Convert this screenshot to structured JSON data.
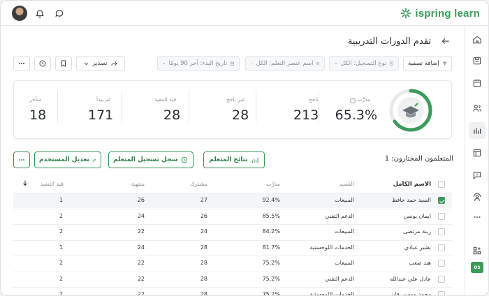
{
  "brand": {
    "name": "ispring learn",
    "accent": "#3d9a5b"
  },
  "page": {
    "title": "تقدم الدورات التدريبية"
  },
  "toolbar": {
    "add_filter": "إضافة تصفية",
    "enrollment_type": "نوع التسجيل: الكل",
    "learning_item": "اسم عنصر التعلم: الكل",
    "start_date": "تاريخ البدء: آخر 90 يومًا",
    "export": "تصدير"
  },
  "summary": {
    "trained_label": "مدرَّب",
    "trained_value": "65.3%",
    "trained_fraction": 0.653,
    "passed_label": "ناجح",
    "passed_value": "213",
    "failed_label": "غير ناجح",
    "failed_value": "28",
    "in_progress_label": "قيد التنفيذ",
    "in_progress_value": "28",
    "not_started_label": "لم يبدأ",
    "not_started_value": "171",
    "overdue_label": "متأخر",
    "overdue_value": "18"
  },
  "selection": {
    "count_text": "المتعلمون المختارون: 1",
    "results_button": "نتائج المتعلم",
    "enrollment_log_button": "سجل تسجيل المتعلم",
    "edit_user_button": "تعديل المستخدم"
  },
  "table": {
    "headers": {
      "name": "الاسم الكامل",
      "department": "القسم",
      "trained": "مدرَّب",
      "enrolled": "مشترك",
      "completed": "منتهية",
      "in_progress": "قيد التنفيذ"
    },
    "rows": [
      {
        "name": "السيد حمد حافظ",
        "department": "المبيعات",
        "trained": "92.4%",
        "enrolled": "27",
        "completed": "26",
        "in_progress": "1",
        "checked": true
      },
      {
        "name": "ايمان يونس",
        "department": "الدعم التقني",
        "trained": "85.5%",
        "enrolled": "26",
        "completed": "24",
        "in_progress": "2",
        "checked": false
      },
      {
        "name": "زينة مرتضى",
        "department": "المبيعات",
        "trained": "84.2%",
        "enrolled": "24",
        "completed": "22",
        "in_progress": "2",
        "checked": false
      },
      {
        "name": "بشير عبادي",
        "department": "الخدمات اللوجستية",
        "trained": "81.7%",
        "enrolled": "28",
        "completed": "24",
        "in_progress": "1",
        "checked": false
      },
      {
        "name": "هند صعب",
        "department": "المبيعات",
        "trained": "75.2%",
        "enrolled": "28",
        "completed": "22",
        "in_progress": "2",
        "checked": false
      },
      {
        "name": "عادل علي عبدالله",
        "department": "الدعم التقني",
        "trained": "75.2%",
        "enrolled": "28",
        "completed": "22",
        "in_progress": "2",
        "checked": false
      },
      {
        "name": "محمد موسى فايز",
        "department": "الخدمات اللوجستية",
        "trained": "75.2%",
        "enrolled": "28",
        "completed": "22",
        "in_progress": "2",
        "checked": false
      }
    ]
  },
  "sidebar": {
    "os_badge": "OS",
    "items": [
      "home-icon",
      "save-icon",
      "calendar-icon",
      "users-icon",
      "reports-icon",
      "window-icon",
      "message-icon",
      "support-icon",
      "more-icon",
      "apps-icon"
    ]
  }
}
